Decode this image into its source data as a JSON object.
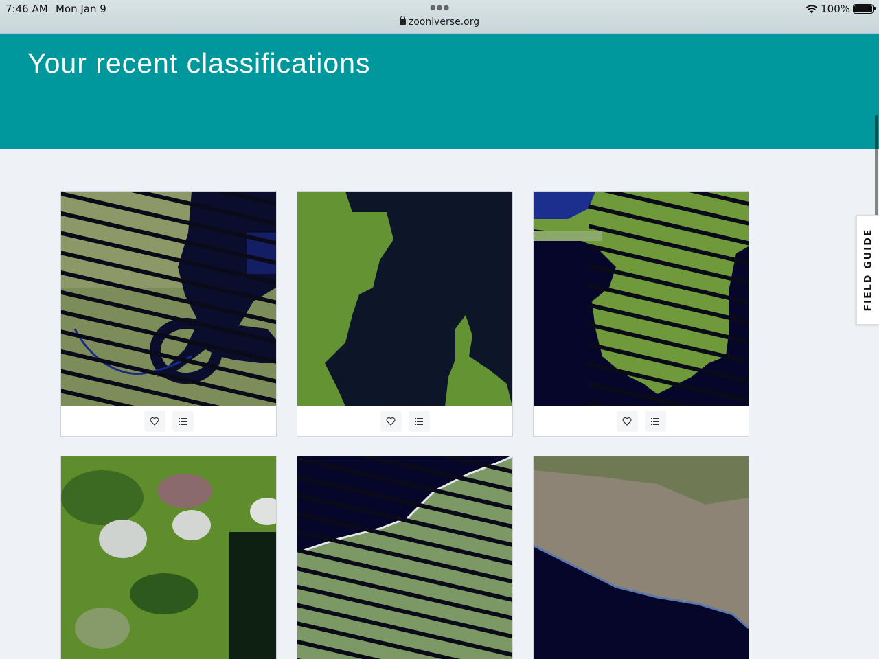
{
  "status_bar": {
    "time": "7:46 AM",
    "date": "Mon Jan 9",
    "url": "zooniverse.org",
    "battery": "100%"
  },
  "page": {
    "title": "Your recent classifications"
  },
  "field_guide": {
    "label": "FIELD GUIDE"
  },
  "colors": {
    "header_teal": "#00979d",
    "page_bg": "#eef1f5",
    "water": "#05062a",
    "land_green": "#6f9b3a"
  },
  "cards": [
    {
      "image": "satellite-river-with-stripes",
      "favorite_icon": "heart-icon",
      "collections_icon": "list-icon"
    },
    {
      "image": "satellite-coast-and-island",
      "favorite_icon": "heart-icon",
      "collections_icon": "list-icon"
    },
    {
      "image": "satellite-bay-with-stripes",
      "favorite_icon": "heart-icon",
      "collections_icon": "list-icon"
    },
    {
      "image": "satellite-forest-clouds",
      "favorite_icon": "heart-icon",
      "collections_icon": "list-icon"
    },
    {
      "image": "satellite-shoreline-with-stripes",
      "favorite_icon": "heart-icon",
      "collections_icon": "list-icon"
    },
    {
      "image": "satellite-mountain-coast",
      "favorite_icon": "heart-icon",
      "collections_icon": "list-icon"
    }
  ]
}
